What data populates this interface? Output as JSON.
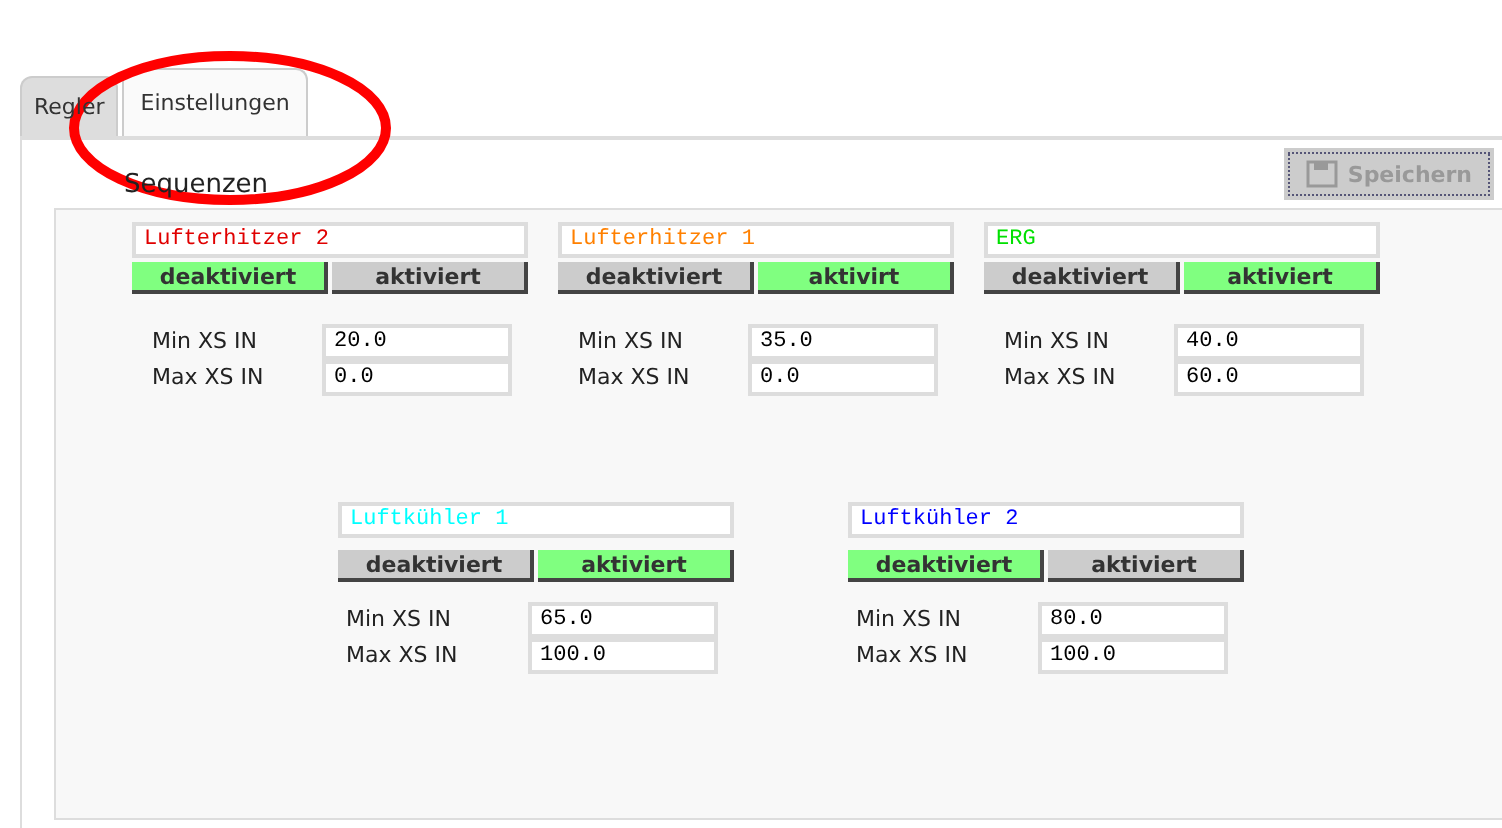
{
  "tabs": [
    {
      "label": "Regler",
      "selected": false
    },
    {
      "label": "Einstellungen",
      "selected": true
    }
  ],
  "section_title": "Sequenzen",
  "save_button": {
    "label": "Speichern",
    "disabled": true
  },
  "sequence_rows": [
    {
      "groups": [
        {
          "name": "Lufterhitzer 2",
          "color": "#e00000",
          "buttons": [
            {
              "label": "deaktiviert",
              "selected": true
            },
            {
              "label": "aktiviert",
              "selected": false
            }
          ],
          "fields": [
            {
              "label": "Min XS IN",
              "value": "20.0"
            },
            {
              "label": "Max XS IN",
              "value": "0.0"
            }
          ]
        },
        {
          "name": "Lufterhitzer 1",
          "color": "#ff8000",
          "buttons": [
            {
              "label": "deaktiviert",
              "selected": false
            },
            {
              "label": "aktivirt",
              "selected": true
            }
          ],
          "fields": [
            {
              "label": "Min XS IN",
              "value": "35.0"
            },
            {
              "label": "Max XS IN",
              "value": "0.0"
            }
          ]
        },
        {
          "name": "ERG",
          "color": "#00e000",
          "buttons": [
            {
              "label": "deaktiviert",
              "selected": false
            },
            {
              "label": "aktiviert",
              "selected": true
            }
          ],
          "fields": [
            {
              "label": "Min XS IN",
              "value": "40.0"
            },
            {
              "label": "Max XS IN",
              "value": "60.0"
            }
          ]
        }
      ]
    },
    {
      "groups": [
        {
          "name": "Luftkühler 1",
          "color": "#00ffff",
          "buttons": [
            {
              "label": "deaktiviert",
              "selected": false
            },
            {
              "label": "aktiviert",
              "selected": true
            }
          ],
          "fields": [
            {
              "label": "Min XS IN",
              "value": "65.0"
            },
            {
              "label": "Max XS IN",
              "value": "100.0"
            }
          ]
        },
        {
          "name": "Luftkühler 2",
          "color": "#0000ff",
          "buttons": [
            {
              "label": "deaktiviert",
              "selected": true
            },
            {
              "label": "aktiviert",
              "selected": false
            }
          ],
          "fields": [
            {
              "label": "Min XS IN",
              "value": "80.0"
            },
            {
              "label": "Max XS IN",
              "value": "100.0"
            }
          ]
        }
      ]
    }
  ],
  "annotation": {
    "kind": "ellipse",
    "color": "#ff0000"
  }
}
